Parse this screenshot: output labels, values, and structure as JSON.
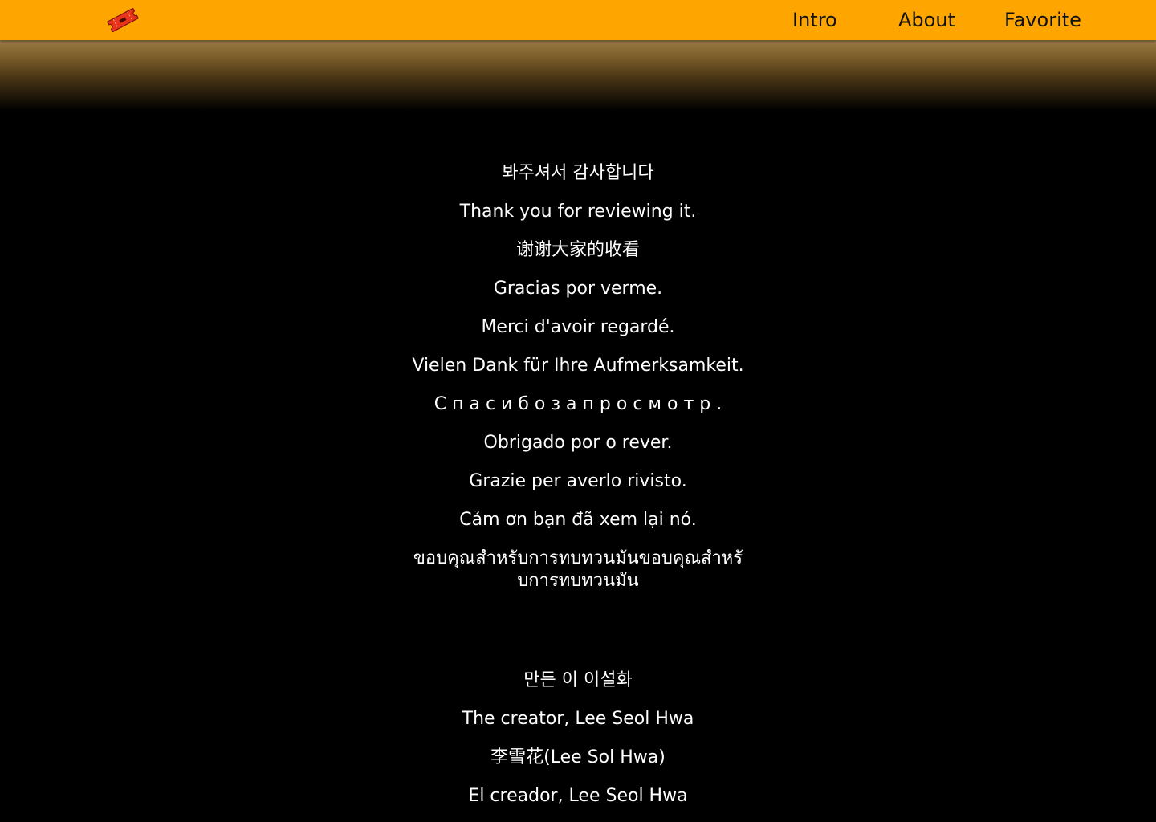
{
  "nav": {
    "logo_icon": "ticket-icon",
    "brand_color": "#ffa500",
    "links": [
      {
        "label": "Intro"
      },
      {
        "label": "About"
      },
      {
        "label": "Favorite"
      }
    ]
  },
  "thanks": [
    "봐주셔서 감사합니다",
    "Thank you for reviewing it.",
    "谢谢大家的收看",
    "Gracias por verme.",
    "Merci d'avoir regardé.",
    "Vielen Dank für Ihre Aufmerksamkeit.",
    "С п а с и б о   з а   п р о с м о т р .",
    "Obrigado por o rever.",
    "Grazie per averlo rivisto.",
    "Cảm ơn bạn đã xem lại nó.",
    "ขอบคุณสำหรับการทบทวนมันขอบคุณสำหรับการทบทวนมัน"
  ],
  "creator": [
    "만든 이 이설화",
    "The creator, Lee Seol Hwa",
    "李雪花(Lee Sol Hwa)",
    "El creador, Lee Seol Hwa"
  ]
}
